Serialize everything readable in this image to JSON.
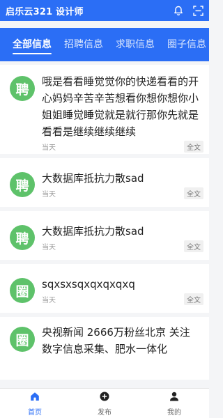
{
  "header": {
    "title": "启乐云321 设计师",
    "icons": [
      "bell-icon",
      "scan-icon"
    ]
  },
  "tabs": [
    {
      "label": "全部信息",
      "active": true
    },
    {
      "label": "招聘信息",
      "active": false
    },
    {
      "label": "求职信息",
      "active": false
    },
    {
      "label": "圈子信息",
      "active": false
    }
  ],
  "posts": [
    {
      "badge": "聘",
      "text": "哦是看看睡觉觉你的快递看看的开心妈妈辛苦辛苦想看你想你想你小姐姐睡觉睡觉就是就行那你先就是看看是继续继续继续",
      "time": "当天",
      "more": "全文"
    },
    {
      "badge": "聘",
      "text": "大数据库抵抗力散sad",
      "time": "当天",
      "more": "全文"
    },
    {
      "badge": "聘",
      "text": "大数据库抵抗力散sad",
      "time": "当天",
      "more": "全文"
    },
    {
      "badge": "圈",
      "text": "sqxsxsqxqxqxqxq",
      "time": "当天",
      "more": "全文"
    },
    {
      "badge": "圈",
      "text": "央视新闻 2666万粉丝北京 关注 数字信息采集、肥水一体化",
      "time": "",
      "more": ""
    }
  ],
  "bottom_nav": [
    {
      "label": "首页",
      "icon": "home-icon",
      "active": true
    },
    {
      "label": "发布",
      "icon": "plus-circle-icon",
      "active": false
    },
    {
      "label": "我的",
      "icon": "user-icon",
      "active": false
    }
  ],
  "colors": {
    "primary": "#2b6ef5",
    "avatar": "#5ec26a"
  }
}
